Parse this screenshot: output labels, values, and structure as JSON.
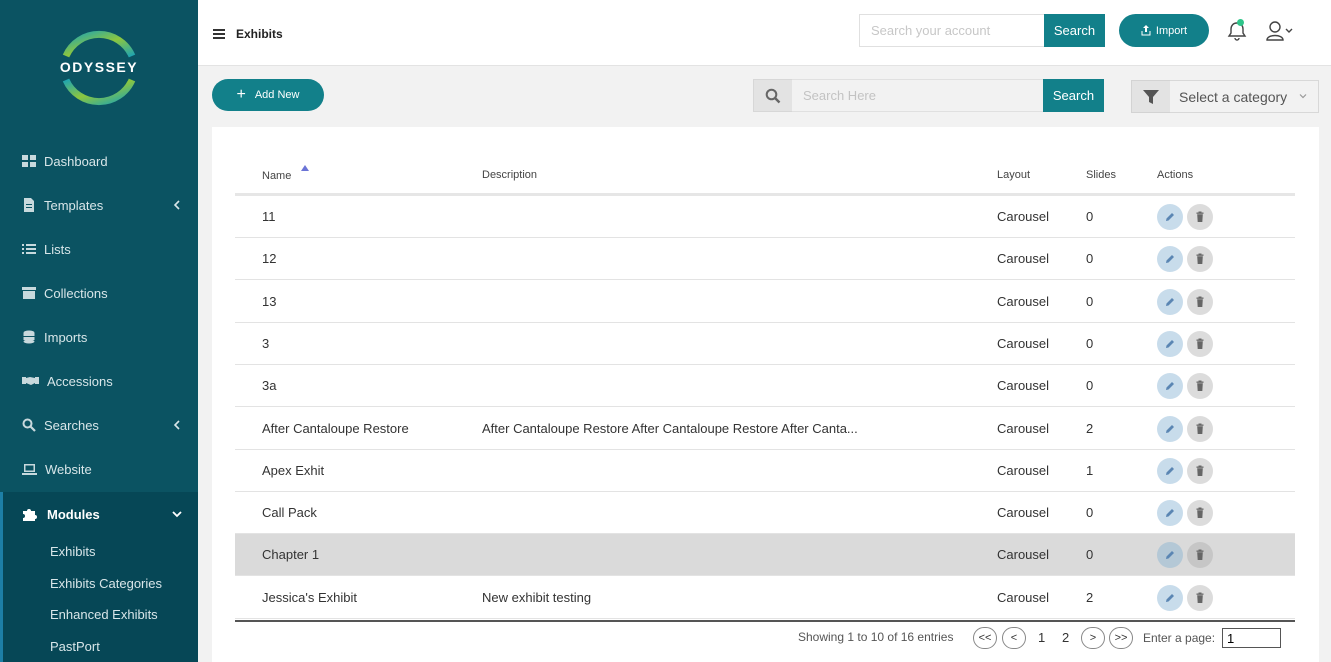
{
  "brand": {
    "name": "ODYSSEY",
    "colors": {
      "sidebar": "#0b5362",
      "accent": "#12808a",
      "logo_ring_green": "#8cc63f",
      "logo_ring_teal": "#1fa4b0"
    }
  },
  "sidebar": {
    "items": [
      {
        "label": "Dashboard",
        "icon": "dashboard-icon"
      },
      {
        "label": "Templates",
        "icon": "document-icon",
        "expandable": true
      },
      {
        "label": "Lists",
        "icon": "list-icon"
      },
      {
        "label": "Collections",
        "icon": "archive-icon"
      },
      {
        "label": "Imports",
        "icon": "database-icon"
      },
      {
        "label": "Accessions",
        "icon": "handshake-icon"
      },
      {
        "label": "Searches",
        "icon": "search-icon",
        "expandable": true
      },
      {
        "label": "Website",
        "icon": "laptop-icon"
      },
      {
        "label": "Modules",
        "icon": "puzzle-icon",
        "expanded": true
      }
    ],
    "sub_items": [
      "Exhibits",
      "Exhibits Categories",
      "Enhanced Exhibits",
      "PastPort"
    ]
  },
  "header": {
    "title": "Exhibits",
    "search_placeholder": "Search your account",
    "search_button": "Search",
    "import_button": "Import"
  },
  "toolbar": {
    "add_button": "Add New",
    "search_placeholder": "Search Here",
    "search_button": "Search",
    "category_placeholder": "Select a category"
  },
  "table": {
    "columns": [
      "Name",
      "Description",
      "Layout",
      "Slides",
      "Actions"
    ],
    "sorted_column": "Name",
    "rows": [
      {
        "name": "11",
        "description": "",
        "layout": "Carousel",
        "slides": "0"
      },
      {
        "name": "12",
        "description": "",
        "layout": "Carousel",
        "slides": "0"
      },
      {
        "name": "13",
        "description": "",
        "layout": "Carousel",
        "slides": "0"
      },
      {
        "name": "3",
        "description": "",
        "layout": "Carousel",
        "slides": "0"
      },
      {
        "name": "3a",
        "description": "",
        "layout": "Carousel",
        "slides": "0"
      },
      {
        "name": "After Cantaloupe Restore",
        "description": "After Cantaloupe Restore After Cantaloupe Restore After Canta...",
        "layout": "Carousel",
        "slides": "2"
      },
      {
        "name": "Apex Exhit",
        "description": "",
        "layout": "Carousel",
        "slides": "1"
      },
      {
        "name": "Call Pack",
        "description": "",
        "layout": "Carousel",
        "slides": "0"
      },
      {
        "name": "Chapter 1",
        "description": "",
        "layout": "Carousel",
        "slides": "0",
        "highlighted": true
      },
      {
        "name": "Jessica's Exhibit",
        "description": "New exhibit testing",
        "layout": "Carousel",
        "slides": "2"
      }
    ]
  },
  "pagination": {
    "summary": "Showing 1 to 10 of 16 entries",
    "first": "<<",
    "prev": "<",
    "pages": [
      "1",
      "2"
    ],
    "next": ">",
    "last": ">>",
    "enter_page_label": "Enter a page:",
    "current_page": "1"
  }
}
